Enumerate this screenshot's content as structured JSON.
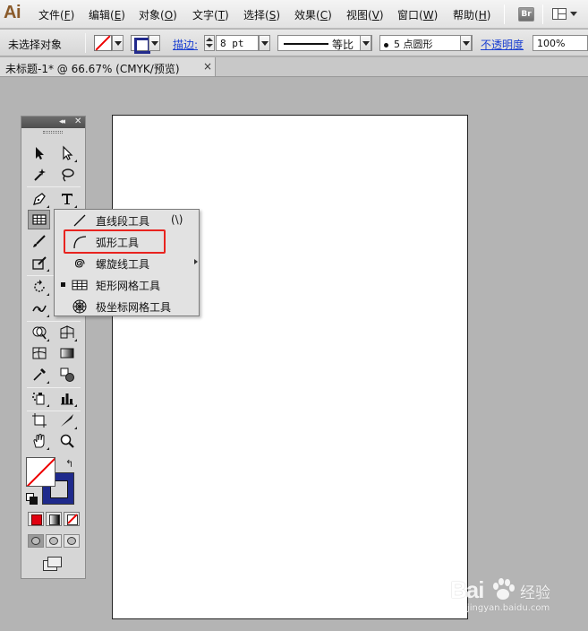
{
  "app": {
    "logo_text": "Ai",
    "bridge_label": "Br"
  },
  "menu": [
    {
      "label": "文件(",
      "acc": "F",
      "end": ")"
    },
    {
      "label": "编辑(",
      "acc": "E",
      "end": ")"
    },
    {
      "label": "对象(",
      "acc": "O",
      "end": ")"
    },
    {
      "label": "文字(",
      "acc": "T",
      "end": ")"
    },
    {
      "label": "选择(",
      "acc": "S",
      "end": ")"
    },
    {
      "label": "效果(",
      "acc": "C",
      "end": ")"
    },
    {
      "label": "视图(",
      "acc": "V",
      "end": ")"
    },
    {
      "label": "窗口(",
      "acc": "W",
      "end": ")"
    },
    {
      "label": "帮助(",
      "acc": "H",
      "end": ")"
    }
  ],
  "control_bar": {
    "selection_status": "未选择对象",
    "stroke_label": "描边:",
    "stroke_weight": "8 pt",
    "profile_label": "等比",
    "brush_label": "5 点圆形",
    "opacity_label": "不透明度",
    "opacity_value": "100%"
  },
  "document_tab": {
    "title": "未标题-1* @ 66.67% (CMYK/预览)",
    "close_symbol": "×"
  },
  "tools_panel": {
    "collapse_symbol": "◂◂",
    "close_symbol": "✕",
    "swap_symbol": "↰"
  },
  "flyout": {
    "items": [
      {
        "label": "直线段工具",
        "shortcut": "(\\)",
        "icon": "line-segment-icon",
        "current": false
      },
      {
        "label": "弧形工具",
        "shortcut": "",
        "icon": "arc-icon",
        "current": false
      },
      {
        "label": "螺旋线工具",
        "shortcut": "",
        "icon": "spiral-icon",
        "current": false
      },
      {
        "label": "矩形网格工具",
        "shortcut": "",
        "icon": "rectangular-grid-icon",
        "current": true
      },
      {
        "label": "极坐标网格工具",
        "shortcut": "",
        "icon": "polar-grid-icon",
        "current": false
      }
    ],
    "highlighted_item": "弧形工具",
    "highlight_color": "#e8231f"
  },
  "watermark": {
    "brand": "Bai",
    "brand_cn": "经验",
    "url": "jingyan.baidu.com"
  },
  "colors": {
    "fill": "none",
    "stroke": "#1f2a8c",
    "accent_link": "#1a3fd1"
  }
}
